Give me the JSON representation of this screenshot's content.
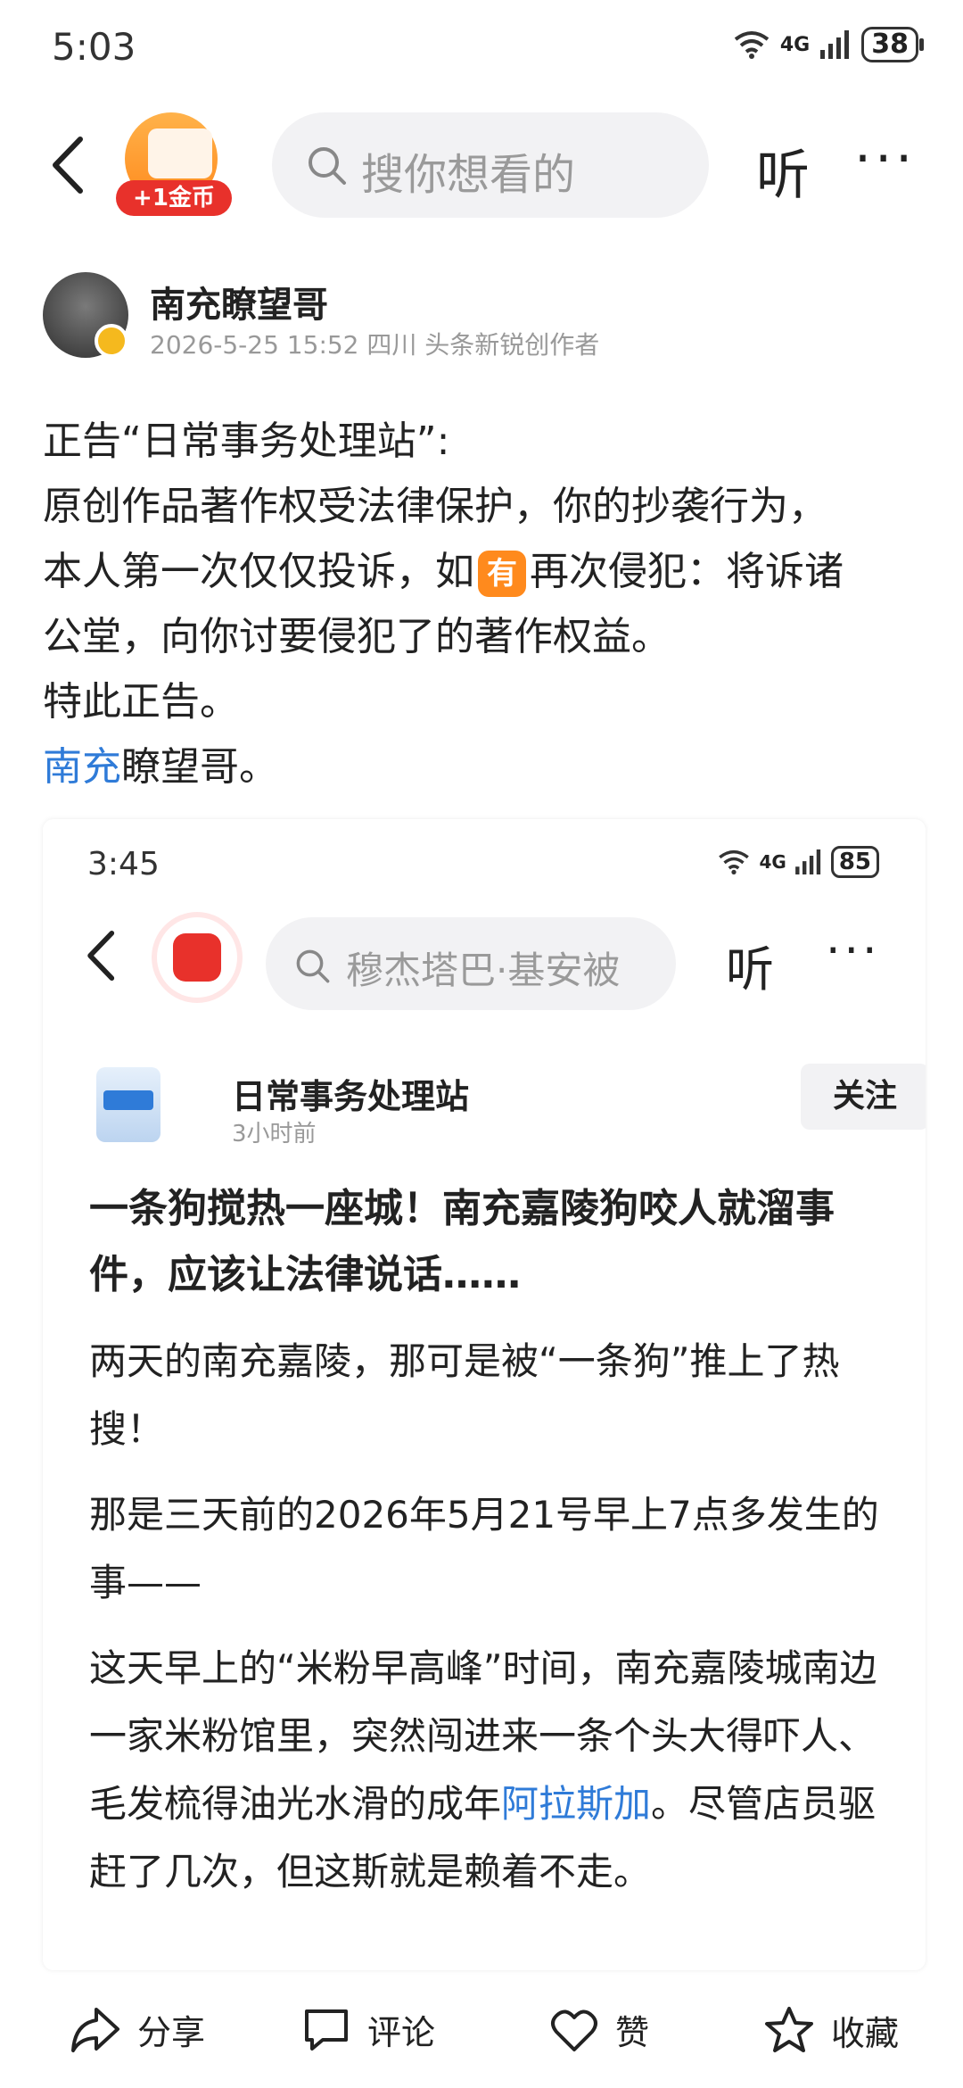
{
  "status_bar": {
    "time": "5:03",
    "network": "4G",
    "battery": "38"
  },
  "topbar": {
    "coin_label": "+1金币",
    "search_placeholder": "搜你想看的",
    "listen_label": "听",
    "more_label": "···"
  },
  "author": {
    "name": "南充瞭望哥",
    "meta": "2026-5-25 15:52 四川 头条新锐创作者"
  },
  "post": {
    "line1": "正告“日常事务处理站”:",
    "line2": "原创作品著作权受法律保护，你的抄袭行为，",
    "line3_a": "本人第一次仅仅投诉，如",
    "you_badge": "有",
    "line3_b": "再次侵犯：将诉诸",
    "line4": "公堂，向你讨要侵犯了的著作权益。",
    "line5": "特此正告。",
    "sign_link": "南充",
    "sign_rest": "瞭望哥。"
  },
  "embedded": {
    "status_time": "3:45",
    "network": "4G",
    "battery": "85",
    "search_text": "穆杰塔巴·基安被",
    "listen_label": "听",
    "more_label": "···",
    "author_name": "日常事务处理站",
    "author_time": "3小时前",
    "follow_label": "关注",
    "title": "一条狗搅热一座城！南充嘉陵狗咬人就溜事件，应该让法律说话……",
    "para1": "两天的南充嘉陵，那可是被“一条狗”推上了热搜！",
    "para2": "那是三天前的2026年5月21号早上7点多发生的事——",
    "para3_a": "这天早上的“米粉早高峰”时间，南充嘉陵城南边一家米粉馆里，突然闯进来一条个头大得吓人、毛发梳得油光水滑的成年",
    "para3_link": "阿拉斯加",
    "para3_b": "。尽管店员驱赶了几次，但这斯就是赖着不走。"
  },
  "bottom_bar": {
    "share": "分享",
    "comment": "评论",
    "like": "赞",
    "collect": "收藏"
  },
  "colors": {
    "link": "#2f7bd8",
    "accent_red": "#e8312b",
    "accent_orange": "#ff8a1d"
  }
}
